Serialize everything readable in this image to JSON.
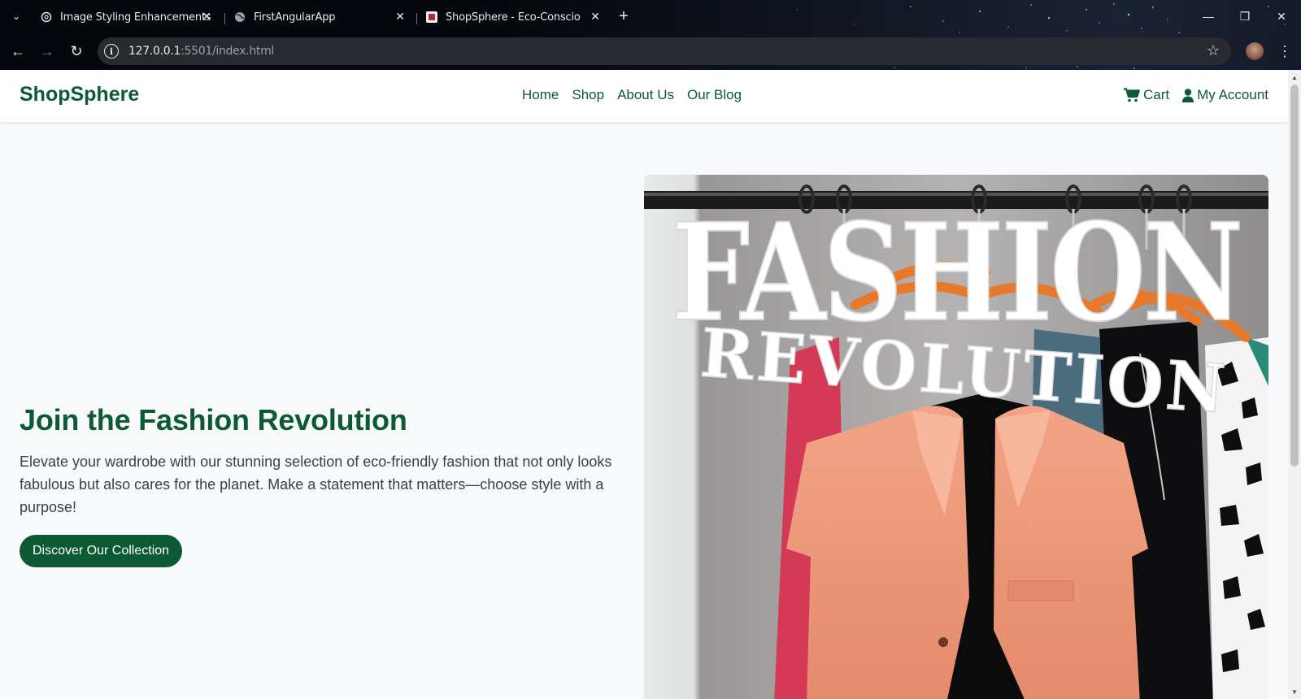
{
  "browser": {
    "tabs": [
      {
        "title": "Image Styling Enhancements",
        "icon": "openai-icon"
      },
      {
        "title": "FirstAngularApp",
        "icon": "globe-icon"
      },
      {
        "title": "ShopSphere - Eco-Conscious F",
        "icon": "shopsphere-favicon",
        "active": true
      }
    ],
    "url_host": "127.0.0.1",
    "url_rest": ":5501/index.html"
  },
  "site": {
    "brand": "ShopSphere",
    "nav": [
      "Home",
      "Shop",
      "About Us",
      "Our Blog"
    ],
    "user_nav": {
      "cart": "Cart",
      "account": "My Account"
    },
    "brand_color": "#0b5a34"
  },
  "hero": {
    "title": "Join the Fashion Revolution",
    "body": "Elevate your wardrobe with our stunning selection of eco-friendly fashion that not only looks fabulous but also cares for the planet. Make a statement that matters—choose style with a purpose!",
    "cta": "Discover Our Collection",
    "image": {
      "line1": "FASHION",
      "line2": "REVOLUTION"
    }
  }
}
